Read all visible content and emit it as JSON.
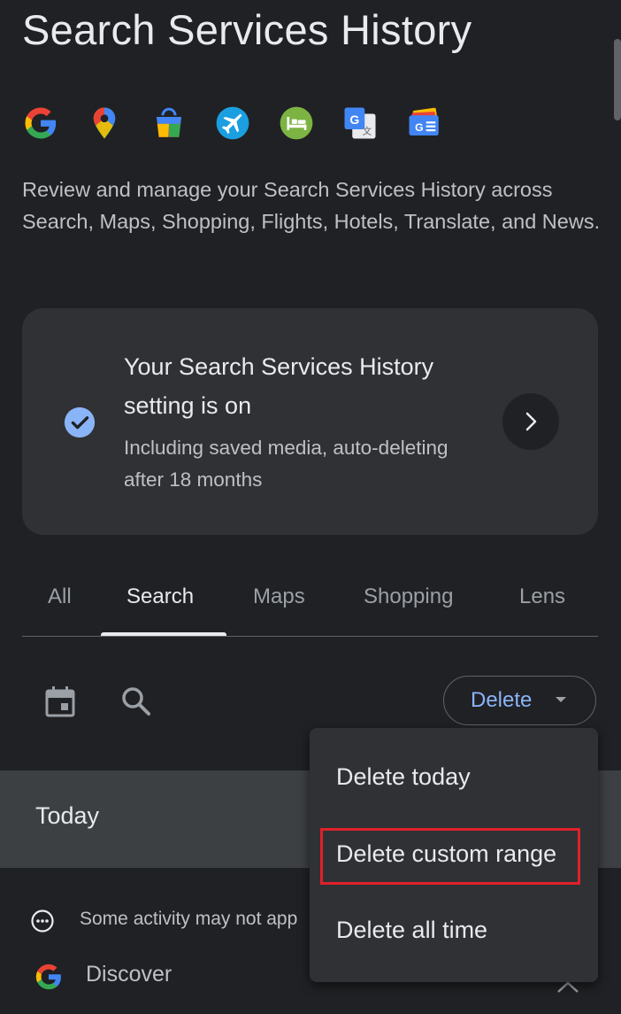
{
  "page": {
    "title": "Search Services History",
    "intro": "Review and manage your Search Services History across Search, Maps, Shopping, Flights, Hotels, Translate, and News."
  },
  "services": [
    {
      "name": "google-g-icon"
    },
    {
      "name": "maps-pin-icon"
    },
    {
      "name": "shopping-bag-icon"
    },
    {
      "name": "flights-plane-icon"
    },
    {
      "name": "hotels-bed-icon"
    },
    {
      "name": "translate-icon"
    },
    {
      "name": "news-icon"
    }
  ],
  "setting_card": {
    "title": "Your Search Services History setting is on",
    "subtitle": "Including saved media, auto-deleting after 18 months",
    "icon": "check-circle-icon"
  },
  "tabs": [
    {
      "label": "All",
      "active": false
    },
    {
      "label": "Search",
      "active": true
    },
    {
      "label": "Maps",
      "active": false
    },
    {
      "label": "Shopping",
      "active": false
    },
    {
      "label": "Lens",
      "active": false
    }
  ],
  "toolbar": {
    "delete_label": "Delete"
  },
  "delete_menu": {
    "items": [
      "Delete today",
      "Delete custom range",
      "Delete all time"
    ],
    "highlighted": "Delete custom range"
  },
  "activity": {
    "date_header": "Today",
    "note": "Some activity may not app",
    "entry_label": "Discover"
  },
  "colors": {
    "background": "#202124",
    "card": "#303134",
    "accent": "#8ab4f8",
    "highlight": "#e0202a"
  }
}
